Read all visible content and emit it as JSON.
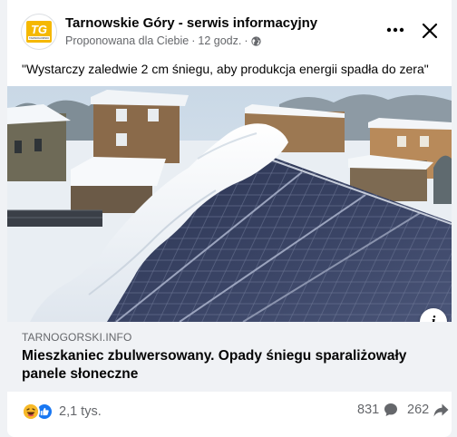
{
  "post": {
    "page_name": "Tarnowskie Góry - serwis informacyjny",
    "suggested": "Proponowana dla Ciebie",
    "separator": "·",
    "time": "12 godz.",
    "text": "\"Wystarczy zaledwie 2 cm śniegu, aby produkcja energii spadła do zera\""
  },
  "logo": {
    "letters": "TG",
    "subtext": "TARNOGORSKI"
  },
  "link": {
    "domain": "TARNOGORSKI.INFO",
    "title": "Mieszkaniec zbulwersowany. Opady śniegu sparaliżowały panele słoneczne"
  },
  "engagement": {
    "reactions": "2,1 tys.",
    "comments": "831",
    "shares": "262"
  },
  "icons": {
    "more": "more-horizontal-icon",
    "close": "close-icon",
    "globe": "globe-icon",
    "info": "info-icon",
    "haha": "haha-reaction-icon",
    "like": "like-reaction-icon",
    "comment": "comment-icon",
    "share": "share-icon"
  },
  "colors": {
    "brand_yellow": "#f5b800",
    "like_blue": "#1877f2",
    "haha_yellow": "#f7b928",
    "text_secondary": "#65676b"
  }
}
